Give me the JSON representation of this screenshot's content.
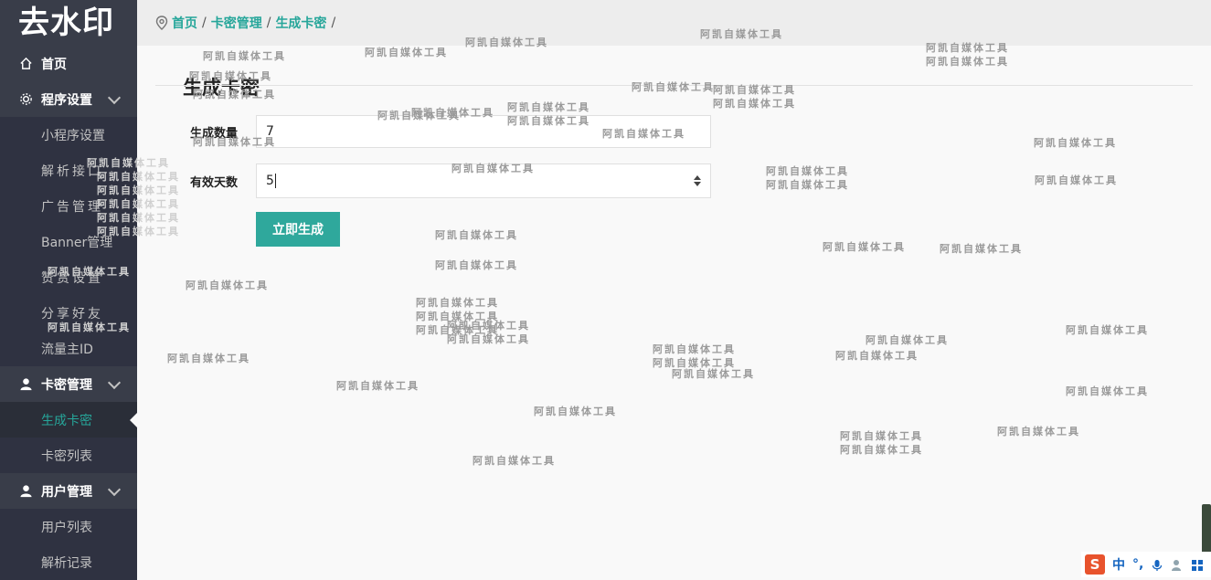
{
  "app": {
    "logo": "去水印"
  },
  "sidebar": {
    "items": [
      {
        "label": "首页",
        "icon": "home-icon"
      },
      {
        "label": "程序设置",
        "icon": "gear-icon"
      },
      {
        "label": "小程序设置"
      },
      {
        "label": "解析接口"
      },
      {
        "label": "广告管理"
      },
      {
        "label": "Banner管理"
      },
      {
        "label": "赞赏设置"
      },
      {
        "label": "分享好友"
      },
      {
        "label": "流量主ID"
      },
      {
        "label": "卡密管理",
        "icon": "user-icon"
      },
      {
        "label": "生成卡密"
      },
      {
        "label": "卡密列表"
      },
      {
        "label": "用户管理",
        "icon": "user-icon"
      },
      {
        "label": "用户列表"
      },
      {
        "label": "解析记录"
      }
    ]
  },
  "breadcrumb": {
    "home": "首页",
    "section": "卡密管理",
    "current": "生成卡密",
    "sep": "/"
  },
  "main": {
    "title": "生成卡密",
    "form": {
      "quantity_label": "生成数量",
      "quantity_value": "7",
      "days_label": "有效天数",
      "days_value": "5",
      "submit_label": "立即生成"
    }
  },
  "watermark": {
    "text": "阿凯自媒体工具"
  },
  "ime": {
    "lang": "中",
    "punct": "°,"
  },
  "colors": {
    "accent": "#26a69a",
    "sidebar_bg": "#393d49",
    "button": "#2fa89c"
  }
}
